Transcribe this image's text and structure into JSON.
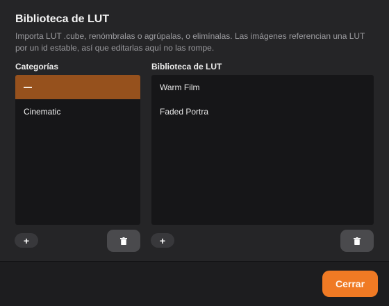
{
  "dialog": {
    "title": "Biblioteca de LUT",
    "description": "Importa LUT .cube, renómbralas o agrúpalas, o elimínalas. Las imágenes referencian una LUT por un id estable, así que editarlas aquí no las rompe."
  },
  "categories": {
    "label": "Categorías",
    "items": [
      {
        "label": "",
        "selected": true
      },
      {
        "label": "Cinematic",
        "selected": false
      }
    ],
    "add_label": "+"
  },
  "library": {
    "label": "Biblioteca de LUT",
    "items": [
      {
        "label": "Warm Film"
      },
      {
        "label": "Faded Portra"
      }
    ],
    "add_label": "+"
  },
  "icons": {
    "delete": "trash-icon",
    "placeholder": "dash-icon"
  },
  "colors": {
    "accent": "#f07a24",
    "selected_row": "#96511d",
    "panel": "#161618",
    "background": "#252527"
  },
  "footer": {
    "close_label": "Cerrar"
  }
}
